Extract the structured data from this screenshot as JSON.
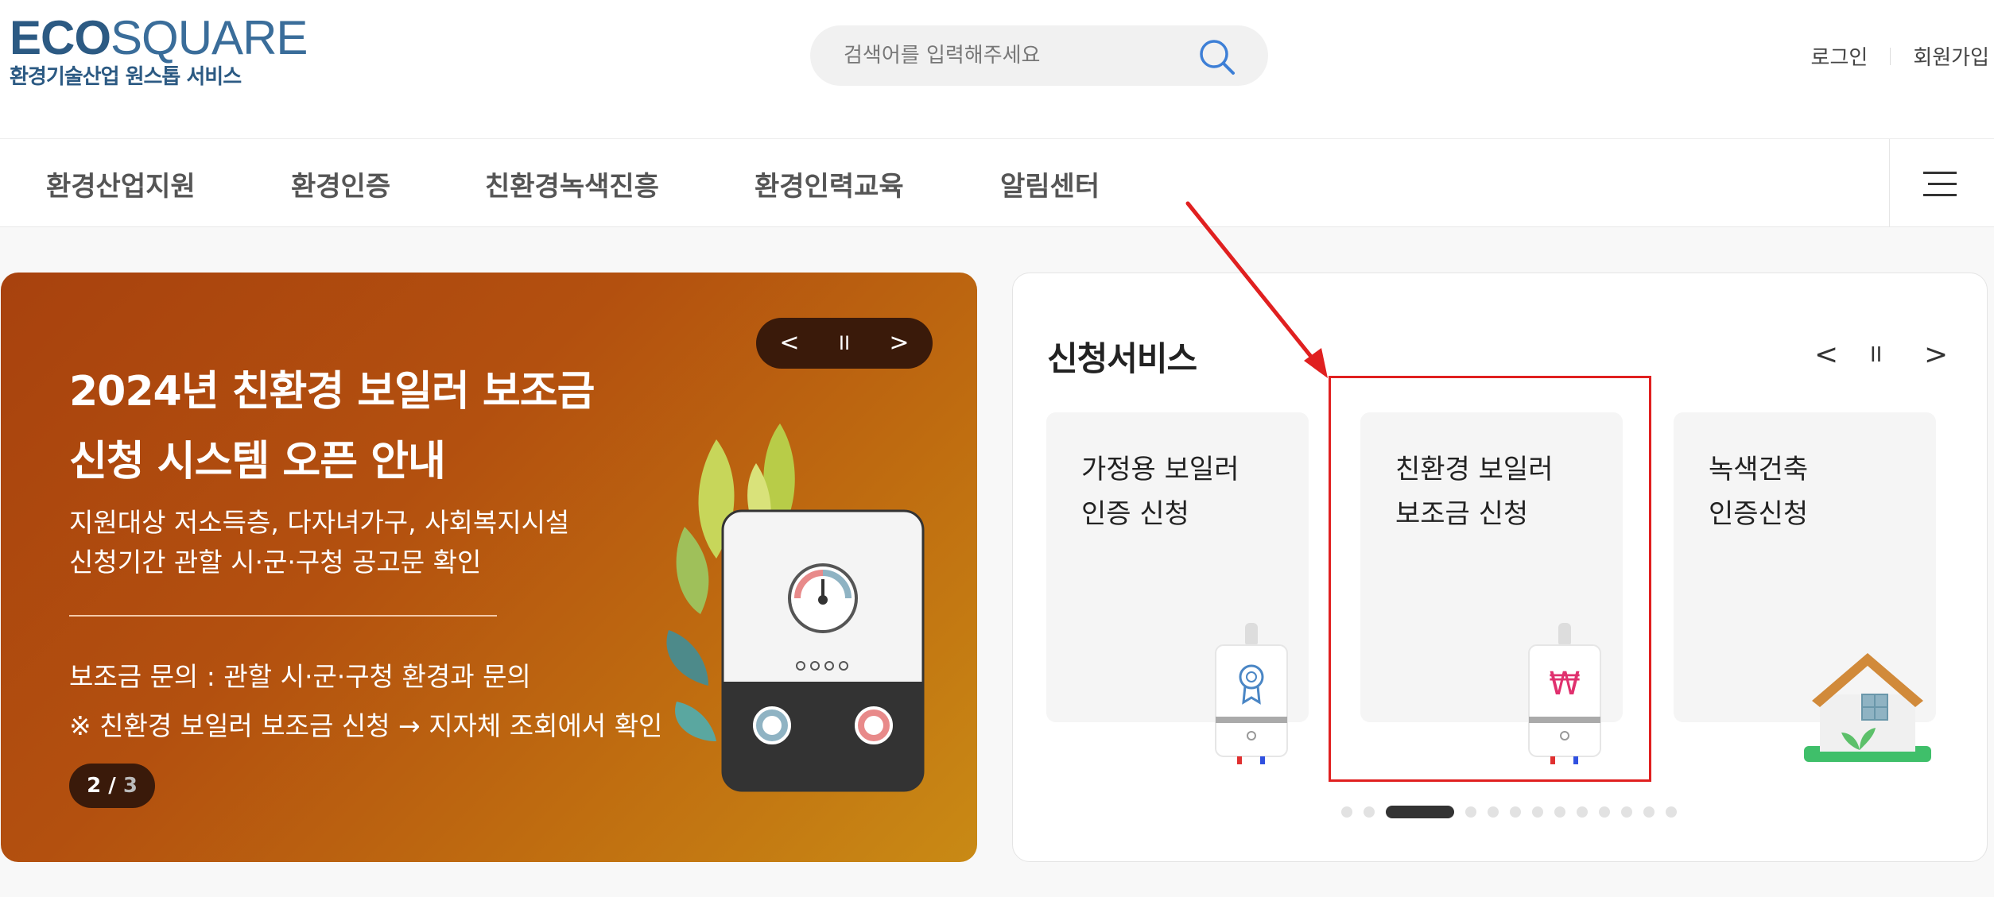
{
  "header": {
    "logo_eco": "ECO",
    "logo_square": "SQUARE",
    "logo_sub": "환경기술산업 원스톱 서비스",
    "search_placeholder": "검색어를 입력해주세요",
    "login": "로그인",
    "signup": "회원가입"
  },
  "nav": {
    "items": [
      "환경산업지원",
      "환경인증",
      "친환경녹색진흥",
      "환경인력교육",
      "알림센터"
    ]
  },
  "banner": {
    "title_line1": "2024년 친환경 보일러 보조금",
    "title_line2": "신청 시스템 오픈 안내",
    "desc_line1": "지원대상 저소득층, 다자녀가구, 사회복지시설",
    "desc_line2": "신청기간 관할 시·군·구청 공고문 확인",
    "info_line1": "보조금 문의 : 관할 시·군·구청 환경과 문의",
    "info_line2": "※  친환경 보일러 보조금 신청 → 지자체 조회에서 확인",
    "pager_current": "2",
    "pager_sep": "/",
    "pager_total": "3",
    "prev": "<",
    "pause": "II",
    "next": ">"
  },
  "services": {
    "title": "신청서비스",
    "prev": "<",
    "pause": "II",
    "next": ">",
    "cards": [
      {
        "line1": "가정용 보일러",
        "line2": "인증 신청",
        "icon": "boiler-certificate-icon"
      },
      {
        "line1": "친환경 보일러",
        "line2": "보조금 신청",
        "icon": "boiler-won-icon"
      },
      {
        "line1": "녹색건축",
        "line2": "인증신청",
        "icon": "green-house-icon"
      }
    ],
    "dot_count": 13,
    "active_dot": 2
  },
  "colors": {
    "brand": "#2c5a83",
    "banner_start": "#a8420e",
    "banner_end": "#c98a15",
    "annotation": "#e02020"
  }
}
